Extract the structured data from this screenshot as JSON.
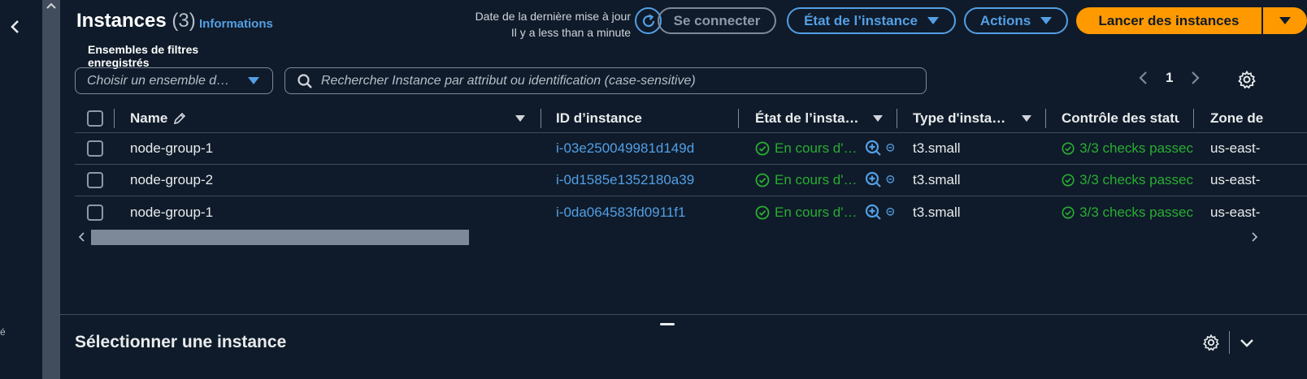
{
  "header": {
    "title": "Instances",
    "count": "(3)",
    "info_link": "Informations",
    "last_update_label": "Date de la dernière mise à jour",
    "last_update_value": "Il y a less than a minute"
  },
  "buttons": {
    "connect": "Se connecter",
    "instance_state": "État de l’instance",
    "actions": "Actions",
    "launch": "Lancer des instances"
  },
  "filters": {
    "saved_label": "Ensembles de filtres enregistrés",
    "saved_placeholder": "Choisir un ensemble d…",
    "search_placeholder": "Rechercher Instance par attribut ou identification (case-sensitive)"
  },
  "pagination": {
    "current_page": "1"
  },
  "table": {
    "columns": [
      "Name",
      "ID d’instance",
      "État de l’insta…",
      "Type d'insta…",
      "Contrôle des statu",
      "Zone de"
    ],
    "rows": [
      {
        "name": "node-group-1",
        "id": "i-03e250049981d149d",
        "state": "En cours d'…",
        "type": "t3.small",
        "status": "3/3 checks passec",
        "zone": "us-east-"
      },
      {
        "name": "node-group-2",
        "id": "i-0d1585e1352180a39",
        "state": "En cours d'…",
        "type": "t3.small",
        "status": "3/3 checks passec",
        "zone": "us-east-"
      },
      {
        "name": "node-group-1",
        "id": "i-0da064583fd0911f1",
        "state": "En cours d'…",
        "type": "t3.small",
        "status": "3/3 checks passec",
        "zone": "us-east-"
      }
    ]
  },
  "details_panel": {
    "title": "Sélectionner une instance"
  },
  "left_rail": {
    "glyph": "é"
  },
  "colors": {
    "accent": "#539fe5",
    "primary": "#ff9900",
    "success": "#29ad32",
    "background": "#0f1b2a"
  }
}
